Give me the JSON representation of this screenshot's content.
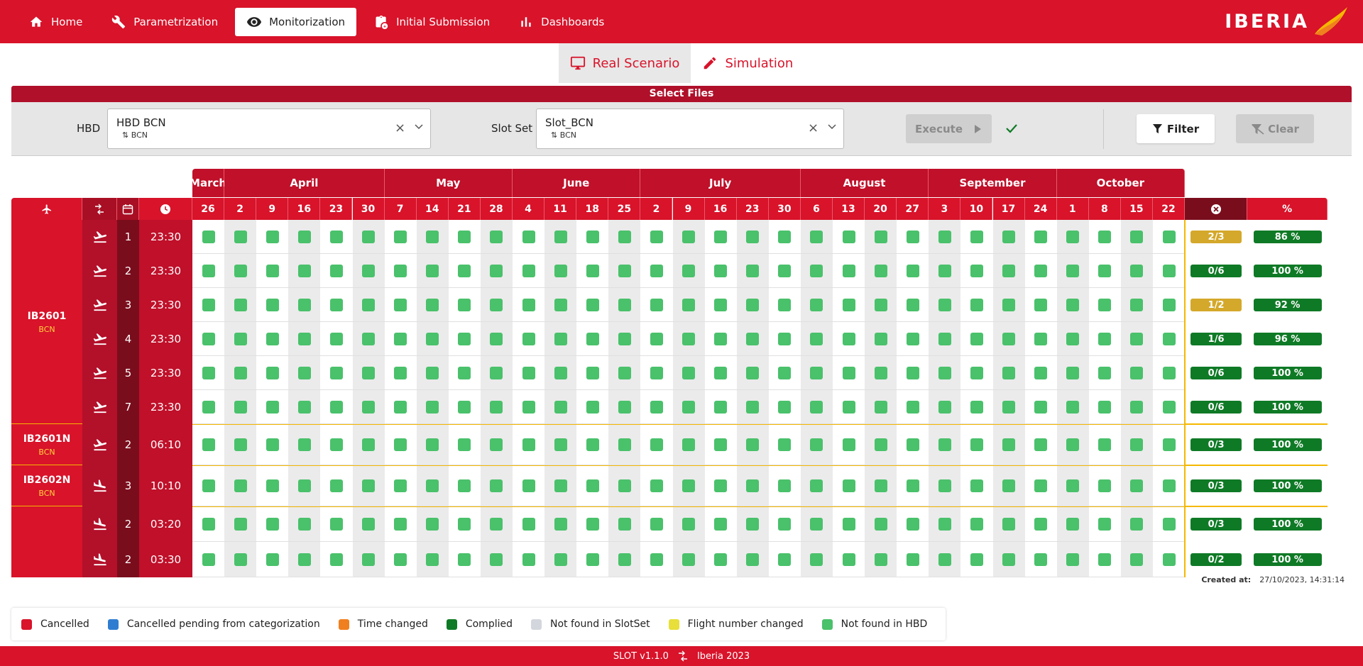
{
  "nav": {
    "items": [
      {
        "label": "Home",
        "icon": "home-icon",
        "active": false
      },
      {
        "label": "Parametrization",
        "icon": "tools-icon",
        "active": false
      },
      {
        "label": "Monitorization",
        "icon": "eye-icon",
        "active": true
      },
      {
        "label": "Initial Submission",
        "icon": "clipboard-icon",
        "active": false
      },
      {
        "label": "Dashboards",
        "icon": "bar-chart-icon",
        "active": false
      }
    ],
    "logo_text": "IBERIA"
  },
  "tabs": [
    {
      "label": "Real Scenario",
      "icon": "monitor-icon",
      "active": true
    },
    {
      "label": "Simulation",
      "icon": "pencil-icon",
      "active": false
    }
  ],
  "select_files": {
    "title": "Select Files",
    "hbd": {
      "label": "HBD",
      "value": "HBD BCN",
      "sub": "BCN"
    },
    "slot_set": {
      "label": "Slot Set",
      "value": "Slot_BCN",
      "sub": "BCN"
    },
    "execute_label": "Execute",
    "filter_label": "Filter",
    "clear_label": "Clear"
  },
  "grid": {
    "months": [
      {
        "name": "March",
        "span": 1
      },
      {
        "name": "April",
        "span": 5
      },
      {
        "name": "May",
        "span": 4
      },
      {
        "name": "June",
        "span": 4
      },
      {
        "name": "July",
        "span": 5
      },
      {
        "name": "August",
        "span": 4
      },
      {
        "name": "September",
        "span": 4
      },
      {
        "name": "October",
        "span": 4
      }
    ],
    "days": [
      "26",
      "2",
      "9",
      "16",
      "23",
      "30",
      "7",
      "14",
      "21",
      "28",
      "4",
      "11",
      "18",
      "25",
      "2",
      "9",
      "16",
      "23",
      "30",
      "6",
      "13",
      "20",
      "27",
      "3",
      "10",
      "17",
      "24",
      "1",
      "8",
      "15",
      "22"
    ],
    "pct_header": "%",
    "groups": [
      {
        "flight": "IB2601",
        "airport": "BCN",
        "rows": 6
      },
      {
        "flight": "IB2601N",
        "airport": "BCN",
        "rows": 1
      },
      {
        "flight": "IB2602N",
        "airport": "BCN",
        "rows": 1
      },
      {
        "flight": "",
        "airport": "",
        "rows": 2
      }
    ],
    "rows": [
      {
        "dir": "takeoff",
        "day": "1",
        "time": "23:30",
        "ratio": "2/3",
        "ratio_status": "warn",
        "pct": "86 %"
      },
      {
        "dir": "takeoff",
        "day": "2",
        "time": "23:30",
        "ratio": "0/6",
        "ratio_status": "ok",
        "pct": "100 %"
      },
      {
        "dir": "takeoff",
        "day": "3",
        "time": "23:30",
        "ratio": "1/2",
        "ratio_status": "warn",
        "pct": "92 %"
      },
      {
        "dir": "takeoff",
        "day": "4",
        "time": "23:30",
        "ratio": "1/6",
        "ratio_status": "ok",
        "pct": "96 %"
      },
      {
        "dir": "takeoff",
        "day": "5",
        "time": "23:30",
        "ratio": "0/6",
        "ratio_status": "ok",
        "pct": "100 %"
      },
      {
        "dir": "takeoff",
        "day": "7",
        "time": "23:30",
        "ratio": "0/6",
        "ratio_status": "ok",
        "pct": "100 %"
      },
      {
        "dir": "takeoff",
        "day": "2",
        "time": "06:10",
        "ratio": "0/3",
        "ratio_status": "ok",
        "pct": "100 %"
      },
      {
        "dir": "landing",
        "day": "3",
        "time": "10:10",
        "ratio": "0/3",
        "ratio_status": "ok",
        "pct": "100 %"
      },
      {
        "dir": "landing",
        "day": "2",
        "time": "03:20",
        "ratio": "0/3",
        "ratio_status": "ok",
        "pct": "100 %"
      },
      {
        "dir": "landing",
        "day": "2",
        "time": "03:30",
        "ratio": "0/2",
        "ratio_status": "ok",
        "pct": "100 %"
      }
    ],
    "colors": {
      "ok": "#0f7a26",
      "warn": "#d4a82a",
      "square": "#4ac16b"
    }
  },
  "created": {
    "label": "Created at:",
    "value": "27/10/2023, 14:31:14"
  },
  "legend": [
    {
      "label": "Cancelled",
      "color": "#d8132a"
    },
    {
      "label": "Cancelled pending from categorization",
      "color": "#2f7dd1"
    },
    {
      "label": "Time changed",
      "color": "#f07f1f"
    },
    {
      "label": "Complied",
      "color": "#0f7a26"
    },
    {
      "label": "Not found in SlotSet",
      "color": "#d3d6dc"
    },
    {
      "label": "Flight number changed",
      "color": "#e8df3a"
    },
    {
      "label": "Not found in HBD",
      "color": "#4ac16b"
    }
  ],
  "footer": {
    "app": "SLOT  v1.1.0",
    "company": "Iberia 2023"
  }
}
